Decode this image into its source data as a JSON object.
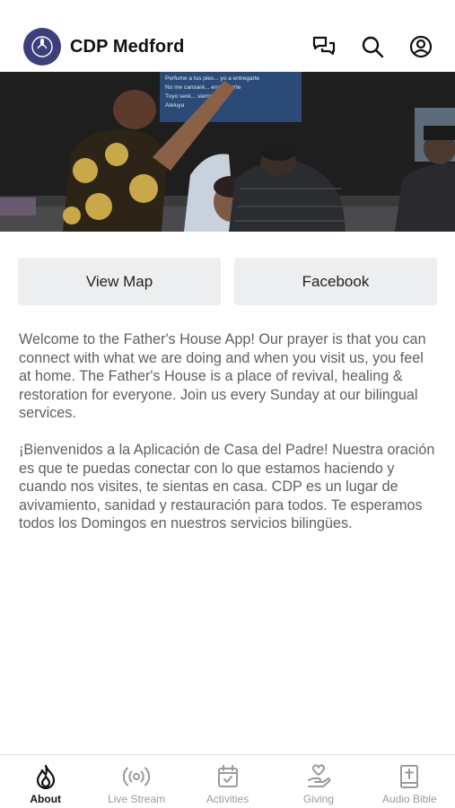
{
  "header": {
    "title": "CDP Medford",
    "logo_icon": "church-logo-icon",
    "icons": [
      "chat-icon",
      "search-icon",
      "account-icon"
    ]
  },
  "hero": {
    "image": "worship-prayer-photo",
    "screen_lines": [
      "Perfume a tus pies... yo a entregarte",
      "No me cansaré... enamorarte",
      "Tuyo seré... siempre",
      "Aleluya"
    ]
  },
  "buttons": {
    "view_map": "View Map",
    "facebook": "Facebook"
  },
  "content": {
    "welcome_en": "Welcome to the Father's House App! Our prayer is that you can connect with what we are doing and when you visit us, you feel at home. The Father's House is a place of revival, healing & restoration for everyone. Join us every Sunday at our bilingual services.",
    "welcome_es": "¡Bienvenidos a la Aplicación de Casa del Padre! Nuestra oración es que te puedas conectar con lo que estamos haciendo y cuando nos visites, te sientas en casa. CDP es un lugar de avivamiento, sanidad y restauración para todos. Te esperamos todos los Domingos en nuestros servicios bilingües."
  },
  "tabbar": {
    "active": "About",
    "tabs": [
      {
        "label": "About",
        "icon": "flame-icon"
      },
      {
        "label": "Live Stream",
        "icon": "broadcast-icon"
      },
      {
        "label": "Activities",
        "icon": "calendar-check-icon"
      },
      {
        "label": "Giving",
        "icon": "giving-hand-icon"
      },
      {
        "label": "Audio Bible",
        "icon": "bible-icon"
      }
    ]
  },
  "colors": {
    "logo_bg": "#3d3f7a",
    "button_bg": "#eceef0",
    "body_text": "#5d5f63",
    "tab_inactive": "#9a9a9a",
    "tab_active": "#111111"
  }
}
